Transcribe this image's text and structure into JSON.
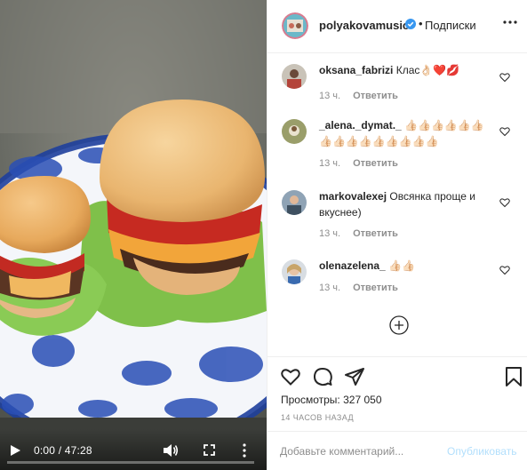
{
  "video": {
    "time_display": "0:00 / 47:28",
    "progress": 0,
    "icons": {
      "play": "play-icon",
      "volume": "volume-icon",
      "fullscreen": "fullscreen-icon",
      "more": "more-vertical-icon"
    }
  },
  "post": {
    "username": "polyakovamusic",
    "verified": true,
    "separator": "•",
    "follow_status": "Подписки",
    "options_icon": "more-horizontal-icon"
  },
  "comments": [
    {
      "username": "oksana_fabrizi",
      "text": "Клас👌🏻❤️💋",
      "time": "13 ч.",
      "reply": "Ответить"
    },
    {
      "username": "_alena._dymat._",
      "text": "👍🏻👍🏻👍🏻👍🏻👍🏻👍🏻👍🏻👍🏻👍🏻👍🏻👍🏻👍🏻👍🏻👍🏻👍🏻",
      "time": "13 ч.",
      "reply": "Ответить"
    },
    {
      "username": "markovalexej",
      "text": "Овсянка проще и вкуснее)",
      "time": "13 ч.",
      "reply": "Ответить"
    },
    {
      "username": "olenazelena_",
      "text": "👍🏻👍🏻",
      "time": "13 ч.",
      "reply": "Ответить"
    }
  ],
  "load_more_icon": "plus-circle-icon",
  "actions": {
    "icons": [
      "heart-icon",
      "comment-icon",
      "share-icon",
      "bookmark-icon"
    ],
    "views_label": "Просмотры:",
    "views_count": "327 050",
    "time_ago": "14 ЧАСОВ НАЗАД"
  },
  "composer": {
    "placeholder": "Добавьте комментарий...",
    "post_label": "Опубликовать"
  },
  "colors": {
    "text": "#262626",
    "secondary": "#8e8e8e",
    "divider": "#efefef",
    "verified_blue": "#3897f0",
    "post_button_disabled": "#b2dffc"
  }
}
